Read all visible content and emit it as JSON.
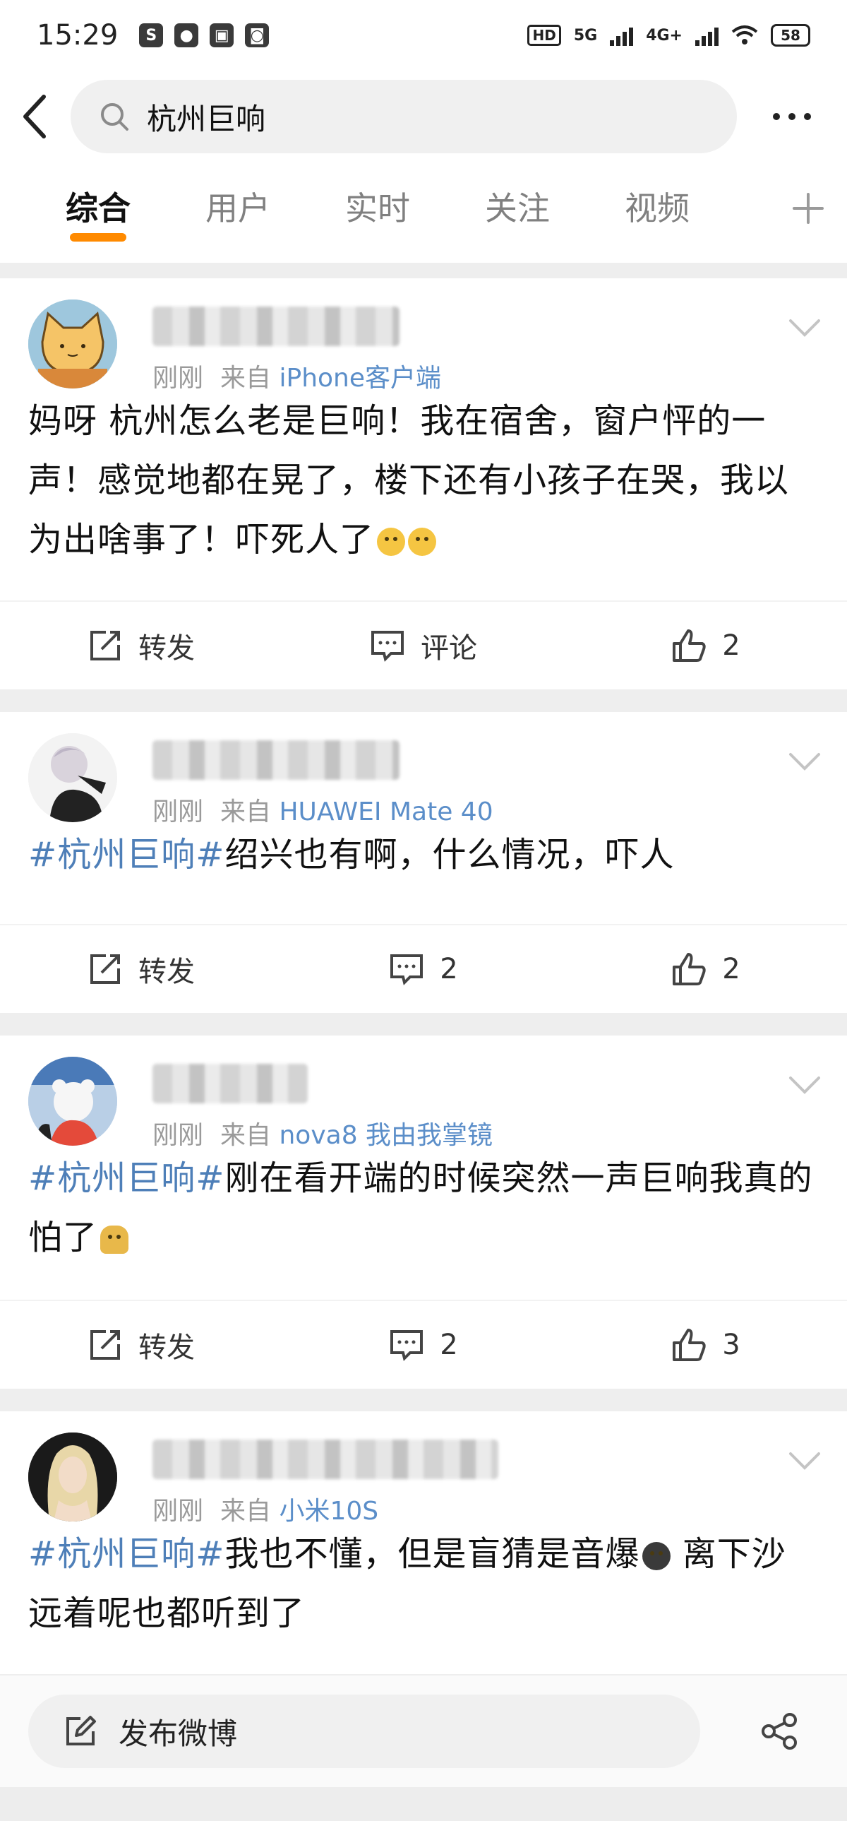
{
  "status_bar": {
    "time": "15:29",
    "app_icons": [
      "S",
      "●",
      "▣",
      "◙"
    ],
    "net1": "5G",
    "net2": "4G+",
    "battery": "58"
  },
  "search": {
    "query": "杭州巨响"
  },
  "tabs": [
    {
      "label": "综合",
      "active": true
    },
    {
      "label": "用户"
    },
    {
      "label": "实时"
    },
    {
      "label": "关注"
    },
    {
      "label": "视频"
    }
  ],
  "posts": [
    {
      "time": "刚刚",
      "from": "来自",
      "source": "iPhone客户端",
      "text": "妈呀 杭州怎么老是巨响！我在宿舍，窗户怦的一声！感觉地都在晃了，楼下还有小孩子在哭，我以为出啥事了！吓死人了",
      "repost": "转发",
      "comment": "评论",
      "likes": "2"
    },
    {
      "time": "刚刚",
      "from": "来自",
      "source": "HUAWEI Mate 40",
      "hashtag": "#杭州巨响#",
      "text": "绍兴也有啊，什么情况，吓人",
      "repost": "转发",
      "comment": "2",
      "likes": "2"
    },
    {
      "time": "刚刚",
      "from": "来自",
      "source": "nova8 我由我掌镜",
      "hashtag": "#杭州巨响#",
      "text": "刚在看开端的时候突然一声巨响我真的怕了",
      "repost": "转发",
      "comment": "2",
      "likes": "3"
    },
    {
      "time": "刚刚",
      "from": "来自",
      "source": "小米10S",
      "hashtag": "#杭州巨响#",
      "text": "我也不懂，但是盲猜是音爆",
      "text2": " 离下沙远着呢也都听到了"
    }
  ],
  "bottom": {
    "compose_label": "发布微博"
  },
  "icons": {
    "back": "chevron-left-icon",
    "search": "search-icon",
    "more": "more-dots-icon",
    "add_tab": "plus-icon",
    "repost": "repost-icon",
    "comment": "comment-icon",
    "like": "thumbs-up-icon",
    "compose": "edit-icon",
    "share": "share-icon"
  },
  "colors": {
    "accent": "#ff8a00",
    "link": "#4e7fb8",
    "muted": "#9a9a9a"
  }
}
